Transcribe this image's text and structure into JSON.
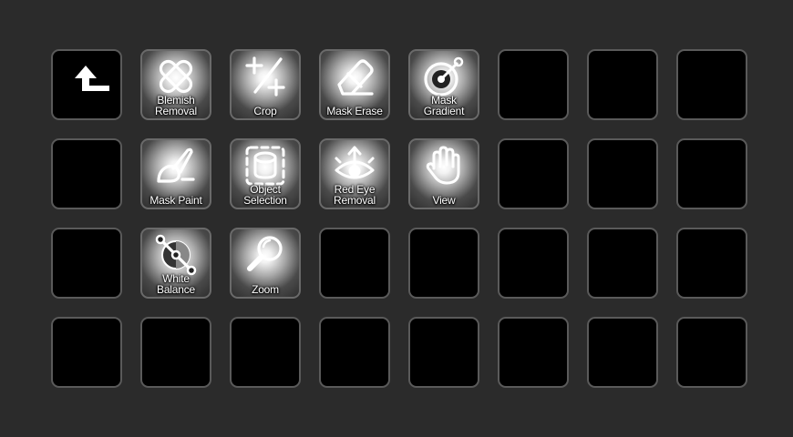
{
  "deck": {
    "back_label": "",
    "tools": {
      "blemish_removal": "Blemish\nRemoval",
      "crop": "Crop",
      "mask_erase": "Mask Erase",
      "mask_gradient": "Mask Gradient",
      "mask_paint": "Mask Paint",
      "object_selection": "Object\nSelection",
      "red_eye_removal": "Red Eye\nRemoval",
      "view": "View",
      "white_balance": "White Balance",
      "zoom": "Zoom"
    },
    "icons": {
      "back": "back-arrow-icon",
      "blemish_removal": "bandage-icon",
      "crop": "crop-icon",
      "mask_erase": "eraser-icon",
      "mask_gradient": "gradient-target-icon",
      "mask_paint": "paint-brush-icon",
      "object_selection": "object-selection-icon",
      "red_eye_removal": "red-eye-icon",
      "view": "hand-icon",
      "white_balance": "white-balance-icon",
      "zoom": "magnifier-icon"
    },
    "colors": {
      "background": "#2b2b2b",
      "key_fill": "#000000",
      "key_border": "#5a5a5a",
      "label": "#ffffff"
    }
  }
}
